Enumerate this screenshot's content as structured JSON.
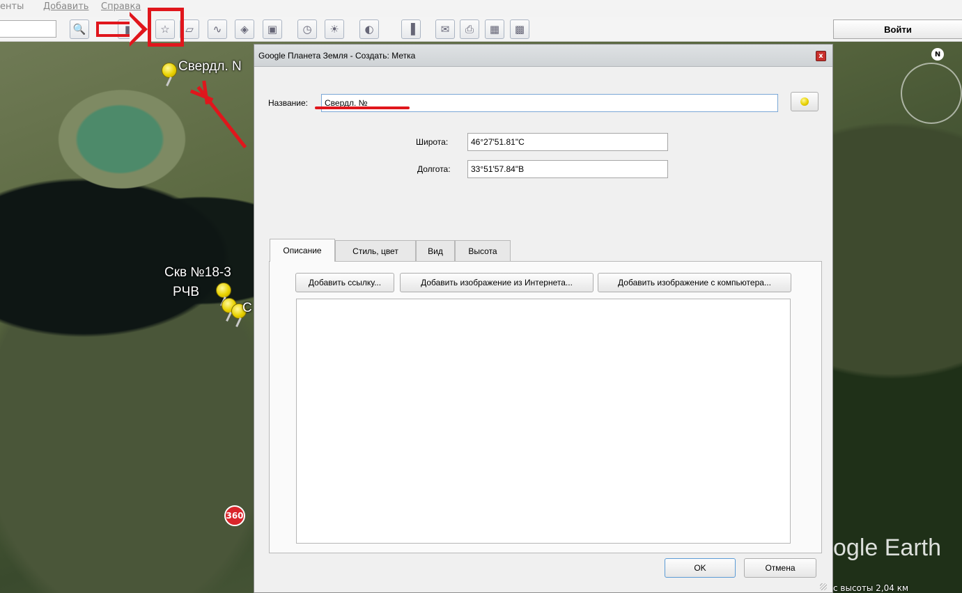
{
  "menu": {
    "items": [
      "енты",
      "Добавить",
      "Справка"
    ]
  },
  "toolbar": {
    "search_value": "",
    "buttons": [
      {
        "icon": "magnifier-icon",
        "glyph": "🔍"
      },
      {
        "icon": "sidebar-toggle-icon",
        "glyph": "▮"
      },
      {
        "icon": "add-placemark-icon",
        "glyph": "☆"
      },
      {
        "icon": "add-polygon-icon",
        "glyph": "▱"
      },
      {
        "icon": "add-path-icon",
        "glyph": "∿"
      },
      {
        "icon": "add-image-overlay-icon",
        "glyph": "◈"
      },
      {
        "icon": "record-tour-icon",
        "glyph": "▣"
      },
      {
        "icon": "historical-imagery-icon",
        "glyph": "◷"
      },
      {
        "icon": "sunlight-icon",
        "glyph": "☀"
      },
      {
        "icon": "planets-icon",
        "glyph": "◐"
      },
      {
        "icon": "ruler-icon",
        "glyph": "▐"
      },
      {
        "icon": "email-icon",
        "glyph": "✉"
      },
      {
        "icon": "print-icon",
        "glyph": "⎙"
      },
      {
        "icon": "view-in-maps-icon",
        "glyph": "▦"
      },
      {
        "icon": "save-image-icon",
        "glyph": "▩"
      }
    ],
    "login_label": "Войти"
  },
  "map": {
    "labels": {
      "sverdl": "Свердл. N",
      "skv": "Скв №18-3",
      "rchv": "РЧВ",
      "c": "С"
    },
    "compass": "N",
    "badge360": "360",
    "watermark": "ogle Earth",
    "status": "с высоты   2,04 км"
  },
  "dialog": {
    "title": "Google Планета Земля - Создать: Метка",
    "close_glyph": "x",
    "name_label": "Название:",
    "name_value": "Свердл. №",
    "latitude_label": "Широта:",
    "latitude_value": "46°27'51.81\"С",
    "longitude_label": "Долгота:",
    "longitude_value": "33°51'57.84\"В",
    "tabs": [
      "Описание",
      "Стиль, цвет",
      "Вид",
      "Высота"
    ],
    "add_link_label": "Добавить ссылку...",
    "add_web_image_label": "Добавить изображение из Интернета...",
    "add_local_image_label": "Добавить изображение с компьютера...",
    "description_value": "",
    "ok_label": "OK",
    "cancel_label": "Отмена"
  },
  "colors": {
    "annotation_red": "#e0161c",
    "pin_yellow": "#e8d200",
    "accent_blue": "#5b9bd5"
  }
}
